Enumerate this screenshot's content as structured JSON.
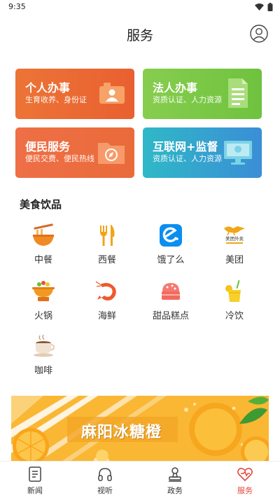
{
  "status_bar": {
    "time": "9:35"
  },
  "header": {
    "title": "服务"
  },
  "service_cards": [
    {
      "title": "个人办事",
      "desc": "生育收养、身份证"
    },
    {
      "title": "法人办事",
      "desc": "资质认证、人力资源"
    },
    {
      "title": "便民服务",
      "desc": "便民交费、便民热线"
    },
    {
      "title": "互联网+监督",
      "desc": "资质认证、人力资源"
    }
  ],
  "food_section": {
    "title": "美食饮品",
    "items": [
      {
        "label": "中餐",
        "icon": "noodle-bowl-icon"
      },
      {
        "label": "西餐",
        "icon": "fork-knife-icon"
      },
      {
        "label": "饿了么",
        "icon": "eleme-icon"
      },
      {
        "label": "美团",
        "icon": "meituan-waimai-icon"
      },
      {
        "label": "火锅",
        "icon": "hotpot-icon"
      },
      {
        "label": "海鲜",
        "icon": "shrimp-icon"
      },
      {
        "label": "甜品糕点",
        "icon": "cake-icon"
      },
      {
        "label": "冷饮",
        "icon": "cold-drink-icon"
      },
      {
        "label": "咖啡",
        "icon": "coffee-cup-icon"
      }
    ],
    "meituan_logo_text": "美团外卖"
  },
  "banner": {
    "text": "麻阳冰糖橙"
  },
  "bottom_nav": {
    "items": [
      {
        "label": "新闻",
        "icon": "news-icon"
      },
      {
        "label": "视听",
        "icon": "headphones-icon"
      },
      {
        "label": "政务",
        "icon": "government-icon"
      },
      {
        "label": "服务",
        "icon": "service-heart-icon",
        "active": true
      }
    ],
    "active_color": "#e6453c"
  }
}
